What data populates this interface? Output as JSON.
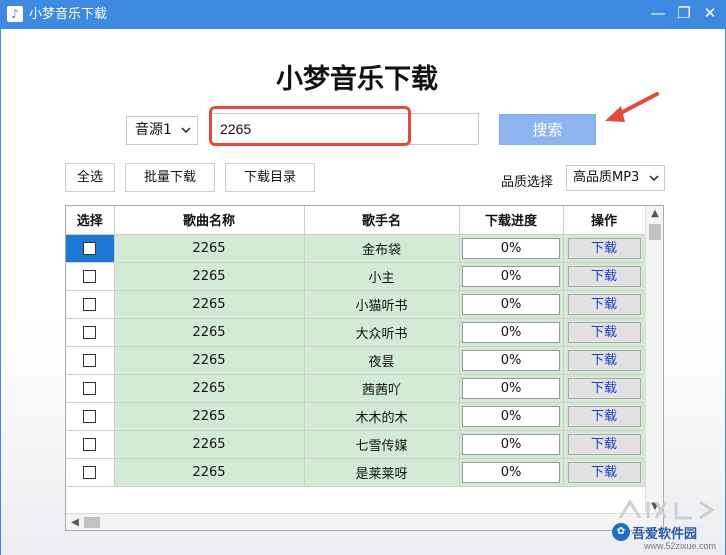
{
  "window": {
    "title": "小梦音乐下载",
    "controls": {
      "minimize": "—",
      "restore": "❐",
      "close": "✕"
    }
  },
  "heading": "小梦音乐下载",
  "search": {
    "source": "音源1",
    "value": "2265",
    "button_label": "搜索"
  },
  "toolbar": {
    "select_all": "全选",
    "batch_download": "批量下载",
    "download_dir": "下载目录",
    "quality_label": "品质选择",
    "quality_value": "高品质MP3"
  },
  "table": {
    "headers": [
      "选择",
      "歌曲名称",
      "歌手名",
      "下载进度",
      "操作"
    ],
    "rows": [
      {
        "song": "2265",
        "artist": "金布袋",
        "progress": "0%",
        "action": "下载"
      },
      {
        "song": "2265",
        "artist": "小主",
        "progress": "0%",
        "action": "下载"
      },
      {
        "song": "2265",
        "artist": "小猫听书",
        "progress": "0%",
        "action": "下载"
      },
      {
        "song": "2265",
        "artist": "大众听书",
        "progress": "0%",
        "action": "下载"
      },
      {
        "song": "2265",
        "artist": "夜昙",
        "progress": "0%",
        "action": "下载"
      },
      {
        "song": "2265",
        "artist": "茜茜吖",
        "progress": "0%",
        "action": "下载"
      },
      {
        "song": "2265",
        "artist": "木木的木",
        "progress": "0%",
        "action": "下载"
      },
      {
        "song": "2265",
        "artist": "七雪传媒",
        "progress": "0%",
        "action": "下载"
      },
      {
        "song": "2265",
        "artist": "是莱莱呀",
        "progress": "0%",
        "action": "下载"
      }
    ]
  },
  "watermark": {
    "brand": "吾爱软件园",
    "url": "www.52zixue.com"
  },
  "colors": {
    "titlebar": "#3e8ae0",
    "row_bg": "#d3ebd4",
    "search_button": "#8db4ee",
    "highlight": "#e04b3b",
    "selected_cell": "#1e78d6"
  }
}
